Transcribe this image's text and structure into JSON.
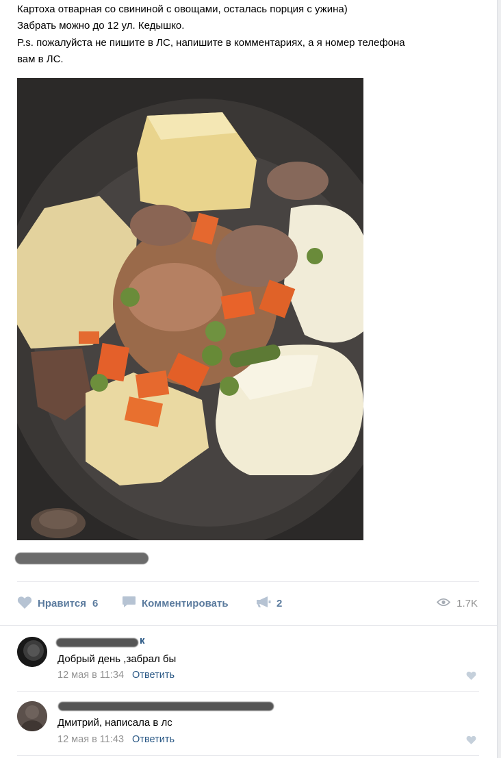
{
  "post": {
    "text_lines": [
      "Картоха отварная со свининой с овощами, осталась порция с ужина)",
      "Забрать можно до 12 ул. Кедышко.",
      "P.s. пожалуйста не пишите в ЛС, напишите в комментариях, а я номер телефона",
      "вам в ЛС."
    ]
  },
  "actions": {
    "like_label": "Нравится",
    "like_count": "6",
    "comment_label": "Комментировать",
    "share_count": "2",
    "views": "1.7K"
  },
  "comments": [
    {
      "author_visible_tail": "к",
      "text": "Добрый день ,забрал бы",
      "time": "12 мая в 11:34",
      "reply_label": "Ответить"
    },
    {
      "text": "Дмитрий, написала в лс",
      "time": "12 мая в 11:43",
      "reply_label": "Ответить"
    }
  ],
  "icons": {
    "like": "heart-icon",
    "comment": "speech-bubble-icon",
    "share": "megaphone-icon",
    "views": "eye-icon"
  },
  "colors": {
    "accent": "#5b7b9e",
    "link": "#2a5885",
    "muted": "#939393"
  }
}
